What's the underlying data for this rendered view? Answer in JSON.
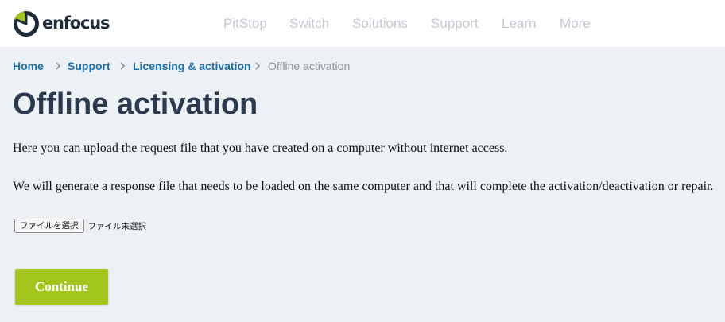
{
  "header": {
    "logo_text": "enfocus",
    "logo_icon": "enfocus-logo-icon",
    "nav": [
      {
        "label": "PitStop"
      },
      {
        "label": "Switch"
      },
      {
        "label": "Solutions"
      },
      {
        "label": "Support"
      },
      {
        "label": "Learn"
      },
      {
        "label": "More"
      }
    ]
  },
  "breadcrumb": {
    "items": [
      {
        "label": "Home"
      },
      {
        "label": "Support"
      },
      {
        "label": "Licensing & activation"
      }
    ],
    "current": "Offline activation",
    "separator_icon": "chevron-right-icon"
  },
  "page": {
    "title": "Offline activation",
    "paragraph_1": "Here you can upload the request file that you have created on a computer without internet access.",
    "paragraph_2": "We will generate a response file that needs to be loaded on the same computer and that will complete the activation/deactivation or repair."
  },
  "file_input": {
    "button_label": "ファイルを選択",
    "status": "ファイル未選択"
  },
  "form": {
    "submit_label": "Continue"
  },
  "colors": {
    "brand_green": "#a2c61e",
    "link_blue": "#1a6ea8",
    "title": "#2b3a4e",
    "nav_muted": "#c5cad2",
    "page_background": "#edf1f5"
  }
}
